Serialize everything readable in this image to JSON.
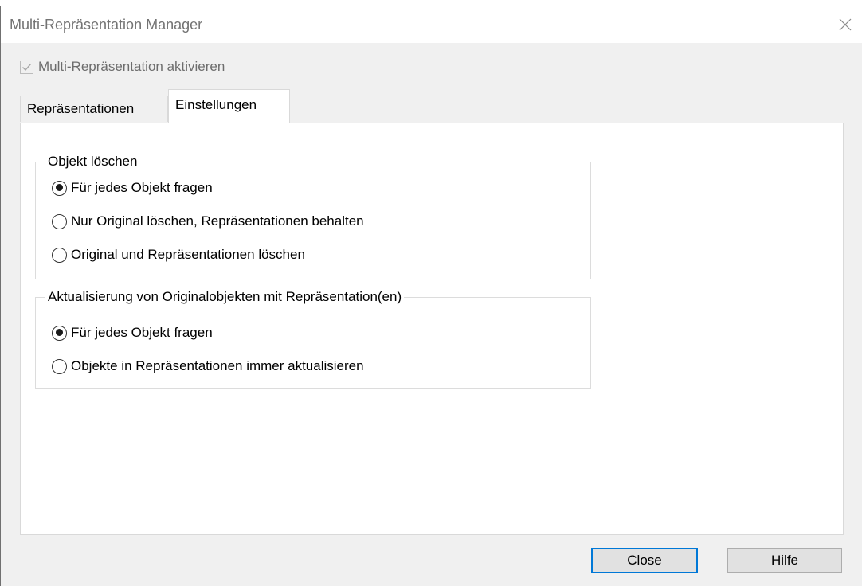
{
  "window": {
    "title": "Multi-Repräsentation Manager"
  },
  "enable": {
    "label": "Multi-Repräsentation aktivieren",
    "checked": true
  },
  "tabs": [
    {
      "label": "Repräsentationen",
      "active": false
    },
    {
      "label": "Einstellungen",
      "active": true
    }
  ],
  "groups": {
    "delete": {
      "title": "Objekt löschen",
      "options": [
        {
          "label": "Für jedes Objekt fragen",
          "checked": true
        },
        {
          "label": "Nur Original löschen, Repräsentationen behalten",
          "checked": false
        },
        {
          "label": "Original und Repräsentationen löschen",
          "checked": false
        }
      ]
    },
    "update": {
      "title": "Aktualisierung von Originalobjekten mit Repräsentation(en)",
      "options": [
        {
          "label": "Für jedes Objekt fragen",
          "checked": true
        },
        {
          "label": "Objekte in Repräsentationen immer aktualisieren",
          "checked": false
        }
      ]
    }
  },
  "buttons": {
    "close": "Close",
    "help": "Hilfe"
  },
  "colors": {
    "accent": "#0078d7",
    "dialog_bg": "#f0f0f0",
    "panel_bg": "#ffffff"
  }
}
